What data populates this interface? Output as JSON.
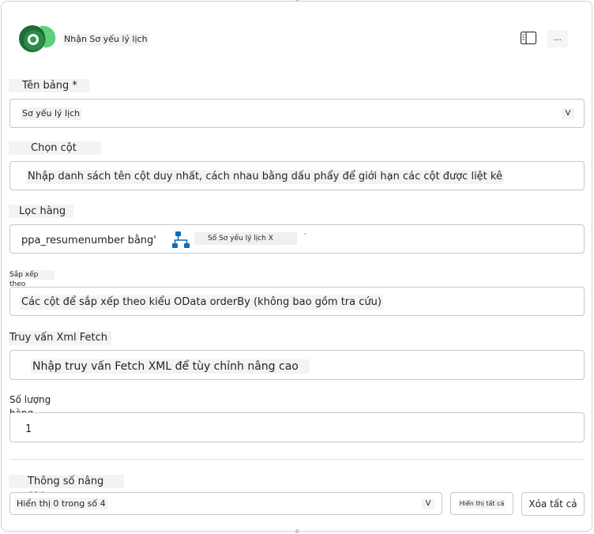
{
  "header": {
    "title": "Nhận Sơ yếu lý lịch",
    "more_label": "...",
    "logo_icon": "dataverse-logo-icon",
    "panel_icon": "side-panel-icon"
  },
  "fields": {
    "table": {
      "label": "Tên bảng *",
      "value": "Sơ yếu lý lịch",
      "chevron": "V"
    },
    "select_columns": {
      "label": "Chọn cột",
      "placeholder": "Nhập danh sách tên cột duy nhất, cách nhau bằng dấu phẩy để giới hạn các cột được liệt kê"
    },
    "filter_rows": {
      "label": "Lọc hàng",
      "expression_prefix": "ppa_resumenumber bằng'",
      "token_label": "Số Sơ yếu lý lịch X",
      "token_suffix": "'"
    },
    "sort_by": {
      "label": "Sắp xếp theo",
      "placeholder": "Các cột để sắp xếp theo kiểu OData orderBy (không bao gồm tra cứu)"
    },
    "fetch_xml": {
      "label": "Truy vấn Xml Fetch",
      "placeholder": "Nhập truy vấn Fetch XML để tùy chỉnh nâng cao"
    },
    "row_count": {
      "label": "Số lượng hàng",
      "value": "1"
    }
  },
  "advanced": {
    "label": "Thông số nâng cao",
    "dropdown_value": "Hiển thị 0 trong số 4",
    "dropdown_chevron": "V",
    "show_all_label": "Hiển thị tất cả",
    "clear_all_label": "Xóa tất cả"
  },
  "colors": {
    "logo_dark": "#1e6b3a",
    "logo_mid": "#2e9c52",
    "logo_light": "#5fcf7a",
    "token_icon": "#0f6cbd"
  }
}
